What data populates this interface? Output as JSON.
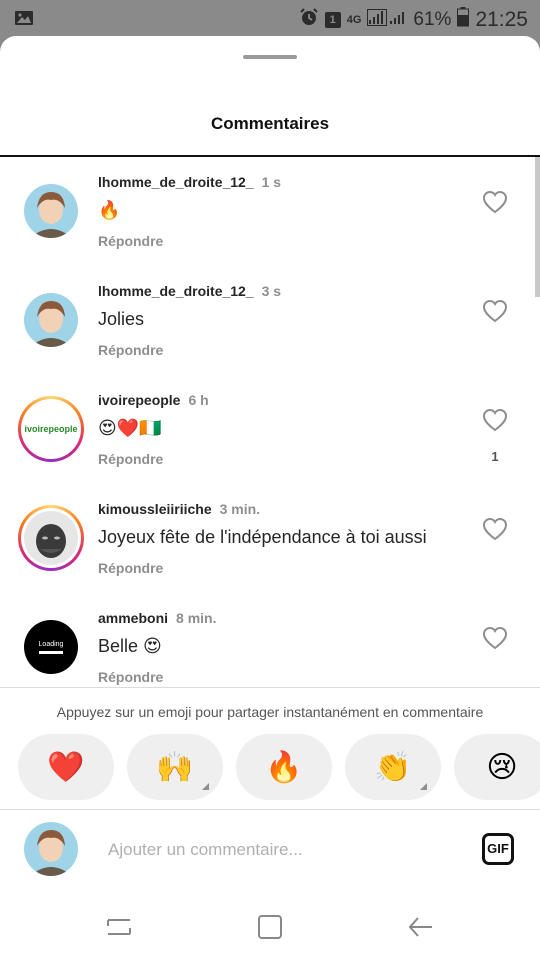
{
  "status_bar": {
    "sim_badge": "1",
    "network": "4G",
    "battery": "61%",
    "time": "21:25"
  },
  "sheet": {
    "title": "Commentaires"
  },
  "comments": [
    {
      "username": "lhomme_de_droite_12_",
      "time": "1 s",
      "text": "🔥",
      "reply": "Répondre",
      "likes": ""
    },
    {
      "username": "lhomme_de_droite_12_",
      "time": "3 s",
      "text": "Jolies",
      "reply": "Répondre",
      "likes": ""
    },
    {
      "username": "ivoirepeople",
      "time": "6 h",
      "text": "😍❤️🇨🇮",
      "reply": "Répondre",
      "likes": "1",
      "avatar_text": "ivoirepeople"
    },
    {
      "username": "kimoussleiiriiche",
      "time": "3 min.",
      "text": "Joyeux fête de l'indépendance à toi aussi",
      "reply": "Répondre",
      "likes": ""
    },
    {
      "username": "ammeboni",
      "time": "8 min.",
      "text": "Belle 😍",
      "reply": "Répondre",
      "likes": "",
      "avatar_text": "Loading"
    }
  ],
  "emoji_bar": {
    "hint": "Appuyez sur un emoji pour partager instantanément en commentaire",
    "emojis": [
      "❤️",
      "🙌",
      "🔥",
      "👏",
      "😢"
    ]
  },
  "composer": {
    "placeholder": "Ajouter un commentaire...",
    "gif_label": "GIF"
  },
  "colors": {
    "status_bar": "#8a8a8a",
    "text_primary": "#262626",
    "text_secondary": "#8e8e8e",
    "pill": "#efefef"
  }
}
